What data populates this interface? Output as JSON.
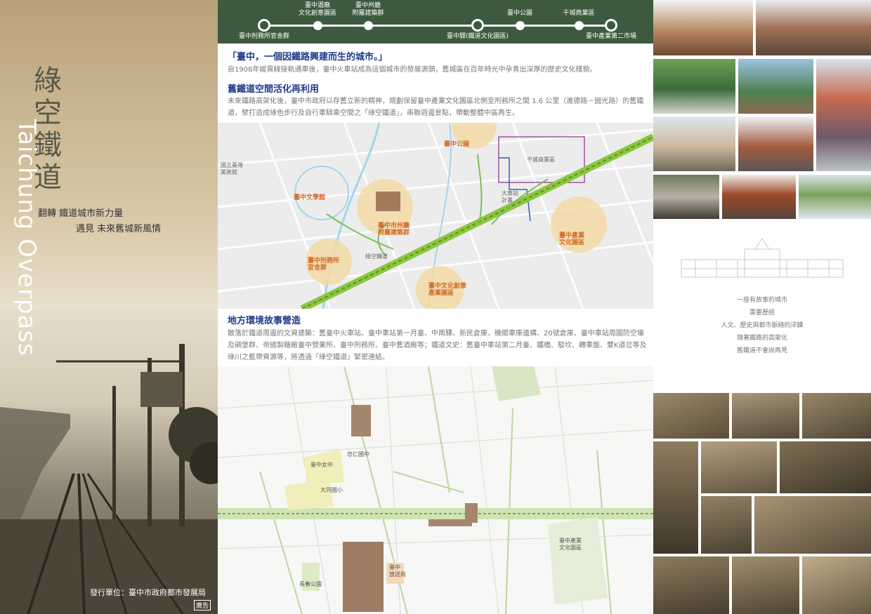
{
  "left": {
    "title_zh": "綠空鐵道",
    "title_en": "Taichung Overpass",
    "subtitle_1": "翻轉  鐵道城市新力量",
    "subtitle_2": "遇見  未來舊城新風情",
    "publisher": "發行單位：臺中市政府都市發展局",
    "stamp": "廣告"
  },
  "timeline": {
    "stops": [
      {
        "label": "臺中刑務所官舍群",
        "pos": "below"
      },
      {
        "label": "臺中酒廠\n文化創意園區",
        "pos": "above"
      },
      {
        "label": "臺中州廳\n附屬建築群",
        "pos": "above"
      },
      {
        "label": "臺中驛(鐵道文化園區)",
        "pos": "below"
      },
      {
        "label": "臺中公園",
        "pos": "above"
      },
      {
        "label": "干城商業區",
        "pos": "above"
      },
      {
        "label": "臺中產業第二市場",
        "pos": "below"
      }
    ]
  },
  "intro": {
    "heading": "「臺中，一個因鐵路興建而生的城市。」",
    "body": "自1908年縱貫線接軌通車後，臺中火車站成為這個城市的發展源頭，舊城區在百年時光中孕育出深厚的歷史文化樣貌。"
  },
  "section1": {
    "heading": "舊鐵道空間活化再利用",
    "body": "未來鐵路高架化後，臺中市政府以存舊立新的精神，規劃保留臺中產業文化園區北側至刑務所之間 1.6 公里（進德路－國光路）的舊鐵道，擘打造成綠色步行及自行車騎乘空間之「綠空鐵道」，串聯週邊景點，帶動整體中區再生。"
  },
  "map1": {
    "labels": [
      {
        "text": "臺中公園",
        "cls": "orange"
      },
      {
        "text": "干城商業區",
        "cls": "gray"
      },
      {
        "text": "國立臺灣\n美術館",
        "cls": "gray"
      },
      {
        "text": "臺中文學館",
        "cls": "orange"
      },
      {
        "text": "臺中市州廳\n附屬建築群",
        "cls": "orange"
      },
      {
        "text": "大車站\n計畫",
        "cls": "gray"
      },
      {
        "text": "臺中產業\n文化園區",
        "cls": "orange"
      },
      {
        "text": "臺中刑務所\n官舍群",
        "cls": "orange"
      },
      {
        "text": "臺中文化創意\n產業園區",
        "cls": "orange"
      },
      {
        "text": "綠空鐵道",
        "cls": "gray"
      }
    ]
  },
  "section2": {
    "heading": "地方環境故事營造",
    "body": "散落於鐵道周邊的文資建築：舊臺中火車站、臺中車站第一月臺、中南驛、新民倉庫、機關車庫遺構、20號倉庫、臺中車站周圍防空壕及碉堡群、帝國製糖廠臺中營業所、臺中刑務所、臺中舊酒廠等；鐵道文史：舊臺中車站第二月臺、鐵橋、駁坎、轉車盤、雙K道岔等及綠川之藍帶資源等，將透過「綠空鐵道」緊密連結。"
  },
  "map2": {
    "labels": [
      {
        "text": "臺中女中"
      },
      {
        "text": "大同國小"
      },
      {
        "text": "忠仁國中"
      },
      {
        "text": "臺中產業\n文化園區"
      },
      {
        "text": "長春公園"
      },
      {
        "text": "臺中\n放送局"
      }
    ]
  },
  "right": {
    "quote_lines": [
      "一座有故事的城市",
      "需要歷經",
      "人文、歷史與都市脈絡的淬鍊",
      "隨著鐵路的高架化",
      "舊鐵道不會說再見"
    ]
  },
  "colors": {
    "timeline_bg": "#3d5a3e",
    "heading_blue": "#1e3a8a",
    "rail_green": "#8cc63f",
    "accent_orange": "#d46a2a"
  }
}
